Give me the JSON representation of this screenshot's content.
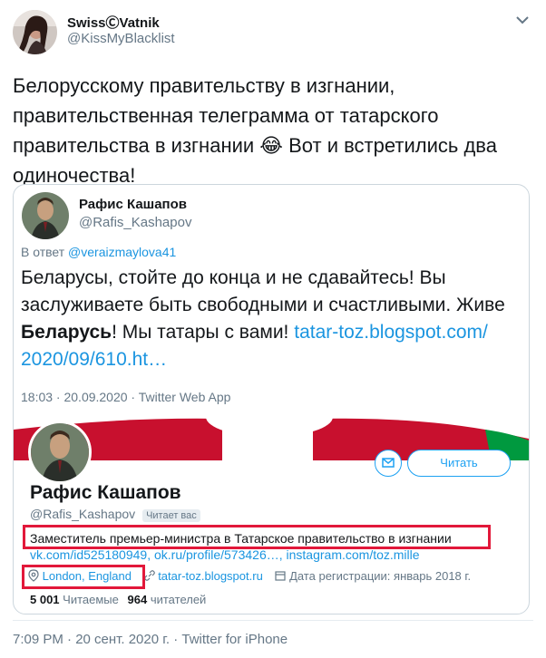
{
  "tweet": {
    "display_name": "SwissⒸVatnik",
    "handle": "@KissMyBlacklist",
    "text_lines": [
      "Белорусскому правительству в изгнании,",
      "правительственная телеграмма от татарского",
      "правительства в изгнании 😂 Вот и встретились два",
      "одиночества!"
    ],
    "footer": "7:09 PM · 20 сент. 2020 г. · Twitter for iPhone",
    "menu_icon": "chevron-down-icon"
  },
  "quoted": {
    "display_name": "Рафис Кашапов",
    "handle": "@Rafis_Kashapov",
    "reply_prefix": "В ответ",
    "reply_to": "@veraizmaylova41",
    "line1": "Беларусы, стойте до конца и не сдавайтесь! Вы",
    "line2": "заслуживаете быть свободными и счастливыми. Живе",
    "line3_bold": "Беларусь",
    "line3_rest": "! Мы татары с вами! ",
    "line3_link": "tatar-toz.blogspot.com/",
    "line4_link": "2020/09/610.ht…",
    "timestamp": "18:03 · 20.09.2020 · Twitter Web App"
  },
  "profile": {
    "name": "Рафис Кашапов",
    "handle": "@Rafis_Kashapov",
    "follows_you": "Читает вас",
    "bio": "Заместитель премьер-министра в Татарское правительство в изгнании",
    "links_line": "vk.com/id525180949, ok.ru/profile/573426…, instagram.com/toz.mille",
    "location": "London, England",
    "website": "tatar-toz.blogspot.ru",
    "joined": "Дата регистрации: январь 2018 г.",
    "following_count": "5 001",
    "following_label": "Читаемые",
    "followers_count": "964",
    "followers_label": "читателей",
    "follow_button": "Читать",
    "colors": {
      "flag_red": "#c8102e",
      "flag_green": "#00993f",
      "highlight": "#e2183a"
    }
  }
}
